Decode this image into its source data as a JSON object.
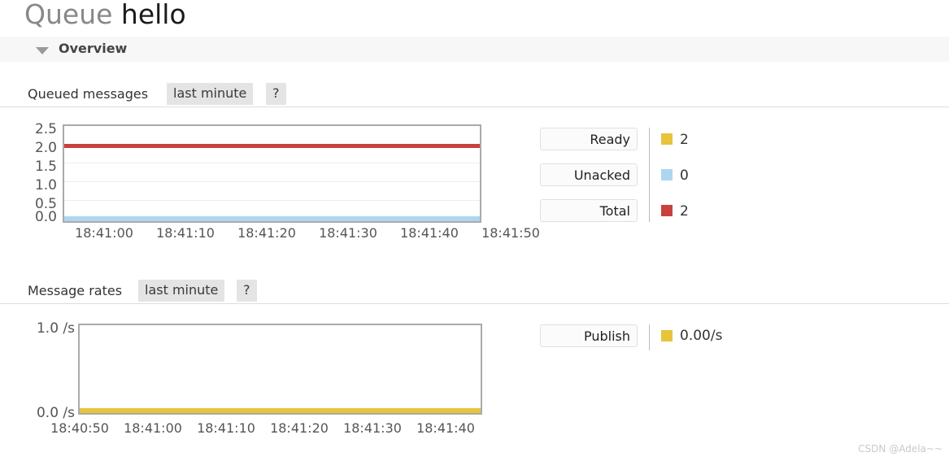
{
  "page": {
    "entity_type": "Queue",
    "entity_name": "hello",
    "watermark": "CSDN @Adela~~"
  },
  "overview": {
    "title": "Overview",
    "collapse_icon": "triangle-down-icon",
    "expanded": true
  },
  "queued_messages": {
    "label": "Queued messages",
    "range_tab": "last minute",
    "help_tab": "?",
    "legend": [
      {
        "label": "Ready",
        "value": "2",
        "color": "#e8c33c"
      },
      {
        "label": "Unacked",
        "value": "0",
        "color": "#aed6f1"
      },
      {
        "label": "Total",
        "value": "2",
        "color": "#c8413d"
      }
    ]
  },
  "message_rates": {
    "label": "Message rates",
    "range_tab": "last minute",
    "help_tab": "?",
    "legend": [
      {
        "label": "Publish",
        "value": "0.00/s",
        "color": "#e8c33c"
      }
    ]
  },
  "chart_data": [
    {
      "type": "line",
      "title": "Queued messages",
      "xlabel": "",
      "ylabel": "",
      "ylim": [
        0,
        2.5
      ],
      "yticks": [
        "2.5",
        "2.0",
        "1.5",
        "1.0",
        "0.5",
        "0.0"
      ],
      "ytick_values": [
        2.5,
        2.0,
        1.5,
        1.0,
        0.5,
        0.0
      ],
      "x": [
        "18:41:00",
        "18:41:10",
        "18:41:20",
        "18:41:30",
        "18:41:40",
        "18:41:50"
      ],
      "grid": true,
      "legend_position": "right",
      "series": [
        {
          "name": "Ready",
          "color": "#e8c33c",
          "values": [
            2,
            2,
            2,
            2,
            2,
            2
          ],
          "current": 2,
          "note": "hidden behind Total line at y=2"
        },
        {
          "name": "Unacked",
          "color": "#aed6f1",
          "values": [
            0,
            0,
            0,
            0,
            0,
            0
          ],
          "current": 0
        },
        {
          "name": "Total",
          "color": "#c8413d",
          "values": [
            2,
            2,
            2,
            2,
            2,
            2
          ],
          "current": 2
        }
      ]
    },
    {
      "type": "line",
      "title": "Message rates",
      "xlabel": "",
      "ylabel": "/s",
      "ylim": [
        0,
        1.0
      ],
      "yticks": [
        "1.0 /s",
        "0.0 /s"
      ],
      "ytick_values": [
        1.0,
        0.0
      ],
      "x": [
        "18:40:50",
        "18:41:00",
        "18:41:10",
        "18:41:20",
        "18:41:30",
        "18:41:40"
      ],
      "grid": false,
      "legend_position": "right",
      "series": [
        {
          "name": "Publish",
          "color": "#e8c33c",
          "values": [
            0,
            0,
            0,
            0,
            0,
            0
          ],
          "current": "0.00/s"
        }
      ]
    }
  ]
}
